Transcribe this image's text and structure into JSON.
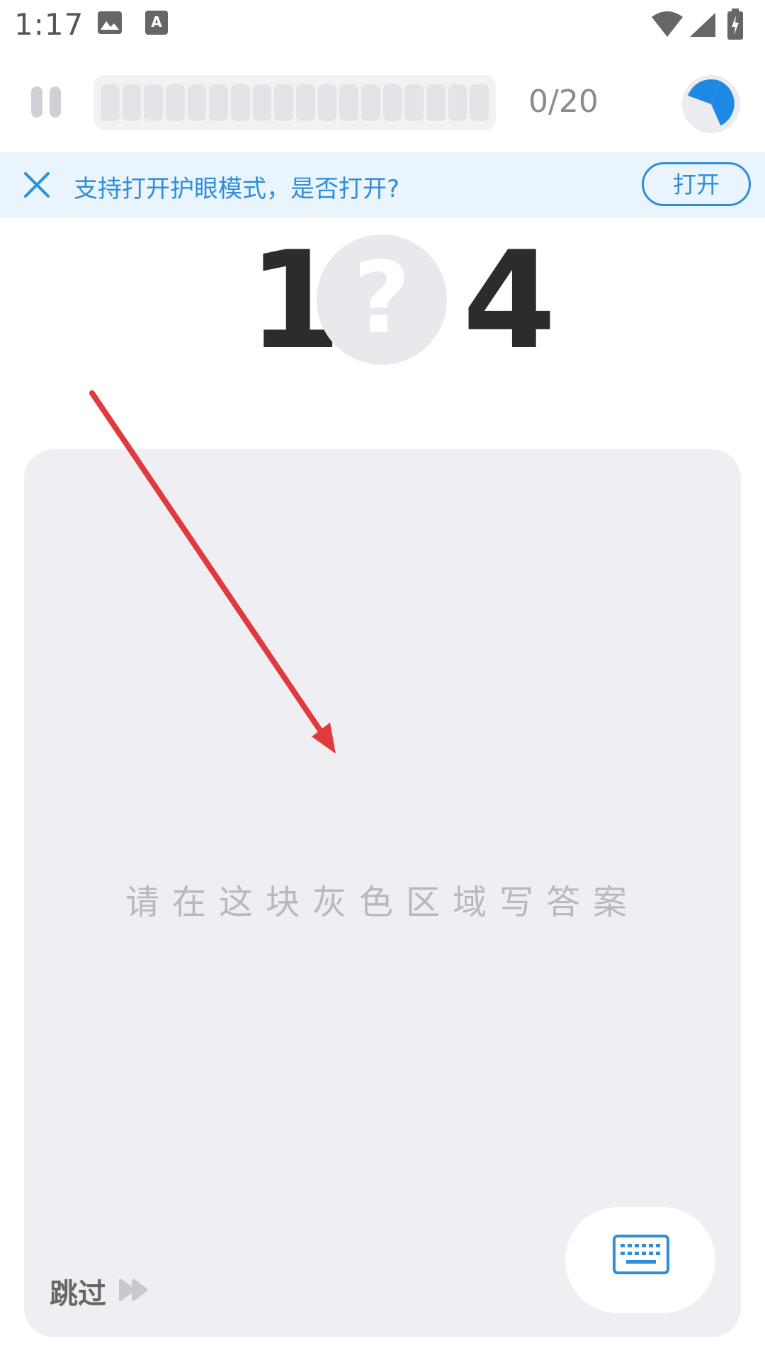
{
  "status_bar": {
    "time": "1:17"
  },
  "top_bar": {
    "counter": "0/20",
    "progress": 0,
    "segments": 18
  },
  "banner": {
    "text": "支持打开护眼模式，是否打开?",
    "button_label": "打开"
  },
  "equation": {
    "left": "1",
    "blank": "?",
    "right": "4"
  },
  "writing_area": {
    "hint": "请在这块灰色区域写答案",
    "skip_label": "跳过"
  },
  "colors": {
    "accent": "#2f8ed8",
    "timer": "#1e88e5",
    "arrow": "#e03a3e",
    "pad": "#efeff3"
  },
  "icons": [
    "image-icon",
    "text-icon",
    "wifi-icon",
    "signal-icon",
    "battery-icon",
    "pause-icon",
    "timer-icon",
    "close-icon",
    "skip-icon",
    "keyboard-icon"
  ]
}
